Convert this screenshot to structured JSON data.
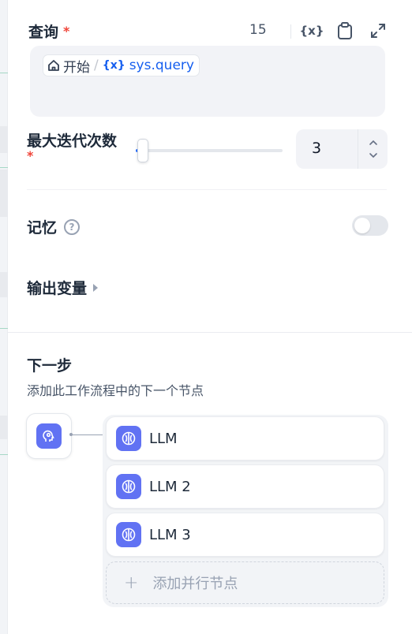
{
  "query": {
    "label": "查询",
    "required_mark": "*",
    "char_count": "15",
    "var_button_label": "{x}",
    "chip": {
      "start_label": "开始",
      "separator": "/",
      "var_prefix": "{x}",
      "var_name": "sys.query"
    }
  },
  "iterations": {
    "label": "最大迭代次数",
    "required_mark": "*",
    "value": "3",
    "slider_fraction": 0.05
  },
  "memory": {
    "label": "记忆",
    "help_glyph": "?",
    "enabled": false
  },
  "output_vars": {
    "label": "输出变量"
  },
  "next_step": {
    "title": "下一步",
    "description": "添加此工作流程中的下一个节点",
    "nodes": [
      {
        "name": "LLM"
      },
      {
        "name": "LLM 2"
      },
      {
        "name": "LLM 3"
      }
    ],
    "add_parallel_label": "添加并行节点",
    "add_glyph": "+"
  },
  "colors": {
    "accent": "#155eef",
    "node_icon_bg": "#6172f3",
    "required": "#f04438"
  }
}
